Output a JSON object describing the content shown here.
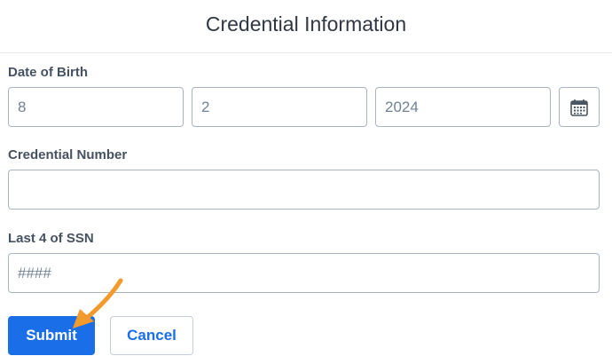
{
  "header": {
    "title": "Credential Information"
  },
  "dob": {
    "label": "Date of Birth",
    "month": "8",
    "day": "2",
    "year_placeholder": "2024",
    "calendar_icon": "calendar-icon"
  },
  "credential": {
    "label": "Credential Number",
    "value": ""
  },
  "ssn": {
    "label": "Last 4 of SSN",
    "placeholder": "####"
  },
  "buttons": {
    "submit_label": "Submit",
    "cancel_label": "Cancel"
  },
  "colors": {
    "accent": "#1a6fe8",
    "pointer_arrow": "#f39a2c"
  }
}
